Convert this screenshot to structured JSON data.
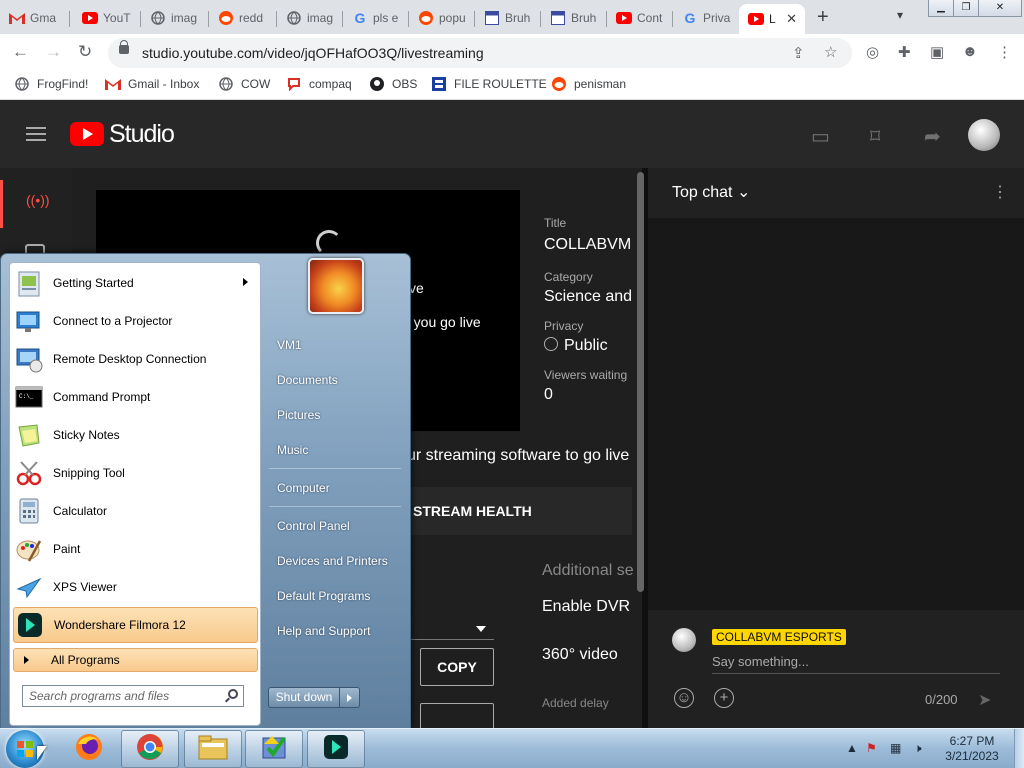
{
  "browser": {
    "tabs": [
      {
        "label": "Gma",
        "icon": "gmail-icon",
        "color": "#d93025"
      },
      {
        "label": "YouT",
        "icon": "youtube-icon",
        "color": "#ff0000"
      },
      {
        "label": "imag",
        "icon": "globe-icon",
        "color": "#5f6368"
      },
      {
        "label": "redd",
        "icon": "reddit-icon",
        "color": "#ff4500"
      },
      {
        "label": "imag",
        "icon": "globe-icon",
        "color": "#5f6368"
      },
      {
        "label": "pls e",
        "icon": "google-icon",
        "color": "#4285f4"
      },
      {
        "label": "popu",
        "icon": "reddit-icon",
        "color": "#ff4500"
      },
      {
        "label": "Bruh",
        "icon": "window-icon",
        "color": "#3c4ba0"
      },
      {
        "label": "Bruh",
        "icon": "window-icon",
        "color": "#3c4ba0"
      },
      {
        "label": "Cont",
        "icon": "youtube-icon",
        "color": "#ff0000"
      },
      {
        "label": "Priva",
        "icon": "google-icon",
        "color": "#4285f4"
      },
      {
        "label": "L",
        "icon": "youtube-icon",
        "color": "#ff0000",
        "active": true
      }
    ],
    "new_tab": "+",
    "url": "studio.youtube.com/video/jqOFHafOO3Q/livestreaming",
    "bookmarks": [
      {
        "label": "FrogFind!",
        "icon": "globe-icon"
      },
      {
        "label": "Gmail - Inbox",
        "icon": "gmail-icon"
      },
      {
        "label": "COW",
        "icon": "globe-icon"
      },
      {
        "label": "compaq",
        "icon": "compaq-icon"
      },
      {
        "label": "OBS",
        "icon": "github-icon"
      },
      {
        "label": "FILE ROULETTE",
        "icon": "file-roulette-icon"
      },
      {
        "label": "penisman",
        "icon": "reddit-icon"
      }
    ]
  },
  "studio": {
    "logo_text": "Studio",
    "preview": {
      "line1": "ve",
      "line2": "e you go live"
    },
    "meta": {
      "title_label": "Title",
      "title_value": "COLLABVM",
      "category_label": "Category",
      "category_value": "Science and",
      "privacy_label": "Privacy",
      "privacy_value": "Public",
      "viewers_label": "Viewers waiting",
      "viewers_value": "0"
    },
    "connect_msg": "ur streaming software to go live",
    "stream_health": "STREAM HEALTH",
    "additional_settings": "Additional se",
    "enable_dvr": "Enable DVR",
    "video_360": "360° video",
    "added_delay": "Added delay",
    "copy_button": "COPY"
  },
  "chat": {
    "header": "Top chat",
    "username": "COLLABVM ESPORTS",
    "placeholder": "Say something...",
    "char_count": "0/200"
  },
  "start_menu": {
    "programs": [
      {
        "label": "Getting Started",
        "icon": "getting-started-icon",
        "submenu": true
      },
      {
        "label": "Connect to a Projector",
        "icon": "projector-icon"
      },
      {
        "label": "Remote Desktop Connection",
        "icon": "remote-desktop-icon"
      },
      {
        "label": "Command Prompt",
        "icon": "command-prompt-icon"
      },
      {
        "label": "Sticky Notes",
        "icon": "sticky-notes-icon"
      },
      {
        "label": "Snipping Tool",
        "icon": "snipping-tool-icon"
      },
      {
        "label": "Calculator",
        "icon": "calculator-icon"
      },
      {
        "label": "Paint",
        "icon": "paint-icon"
      },
      {
        "label": "XPS Viewer",
        "icon": "xps-viewer-icon"
      },
      {
        "label": "Wondershare Filmora 12",
        "icon": "filmora-icon",
        "highlighted": true
      }
    ],
    "all_programs": "All Programs",
    "search_placeholder": "Search programs and files",
    "right_links": [
      "VM1",
      "Documents",
      "Pictures",
      "Music",
      "Computer",
      "Control Panel",
      "Devices and Printers",
      "Default Programs",
      "Help and Support"
    ],
    "shutdown": "Shut down"
  },
  "taskbar": {
    "pinned": [
      "firefox-icon",
      "chrome-icon",
      "file-explorer-icon",
      "installer-icon",
      "filmora-icon"
    ],
    "time": "6:27 PM",
    "date": "3/21/2023"
  }
}
